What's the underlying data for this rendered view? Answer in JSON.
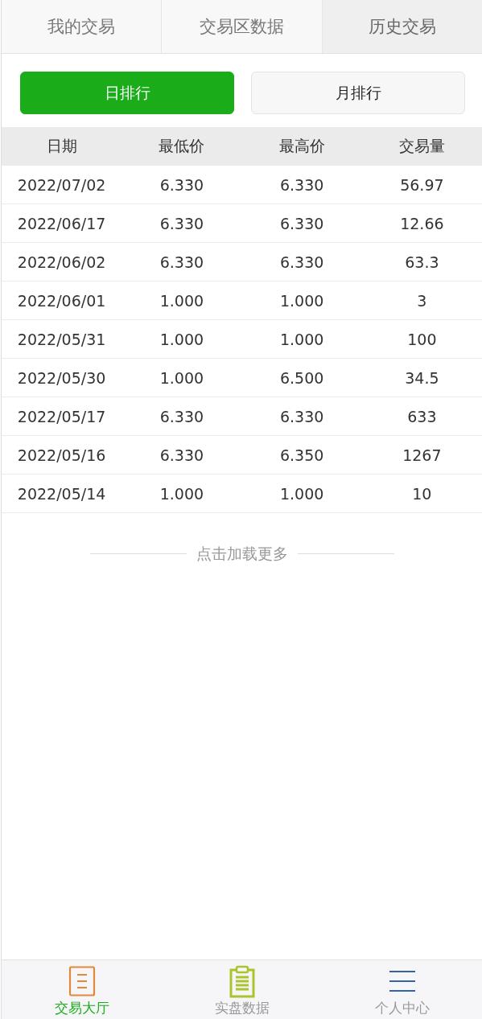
{
  "tabs": [
    {
      "label": "我的交易",
      "selected": false
    },
    {
      "label": "交易区数据",
      "selected": false
    },
    {
      "label": "历史交易",
      "selected": true
    }
  ],
  "ranking_buttons": [
    {
      "label": "日排行",
      "selected": true
    },
    {
      "label": "月排行",
      "selected": false
    }
  ],
  "table": {
    "columns": [
      "日期",
      "最低价",
      "最高价",
      "交易量"
    ],
    "rows": [
      [
        "2022/07/02",
        "6.330",
        "6.330",
        "56.97"
      ],
      [
        "2022/06/17",
        "6.330",
        "6.330",
        "12.66"
      ],
      [
        "2022/06/02",
        "6.330",
        "6.330",
        "63.3"
      ],
      [
        "2022/06/01",
        "1.000",
        "1.000",
        "3"
      ],
      [
        "2022/05/31",
        "1.000",
        "1.000",
        "100"
      ],
      [
        "2022/05/30",
        "1.000",
        "6.500",
        "34.5"
      ],
      [
        "2022/05/17",
        "6.330",
        "6.330",
        "633"
      ],
      [
        "2022/05/16",
        "6.330",
        "6.350",
        "1267"
      ],
      [
        "2022/05/14",
        "1.000",
        "1.000",
        "10"
      ]
    ]
  },
  "load_more": "点击加载更多",
  "bottom_nav": [
    {
      "label": "交易大厅",
      "kind": "document",
      "selected": true
    },
    {
      "label": "实盘数据",
      "kind": "clipboard",
      "selected": false
    },
    {
      "label": "个人中心",
      "kind": "menu",
      "selected": false
    }
  ]
}
